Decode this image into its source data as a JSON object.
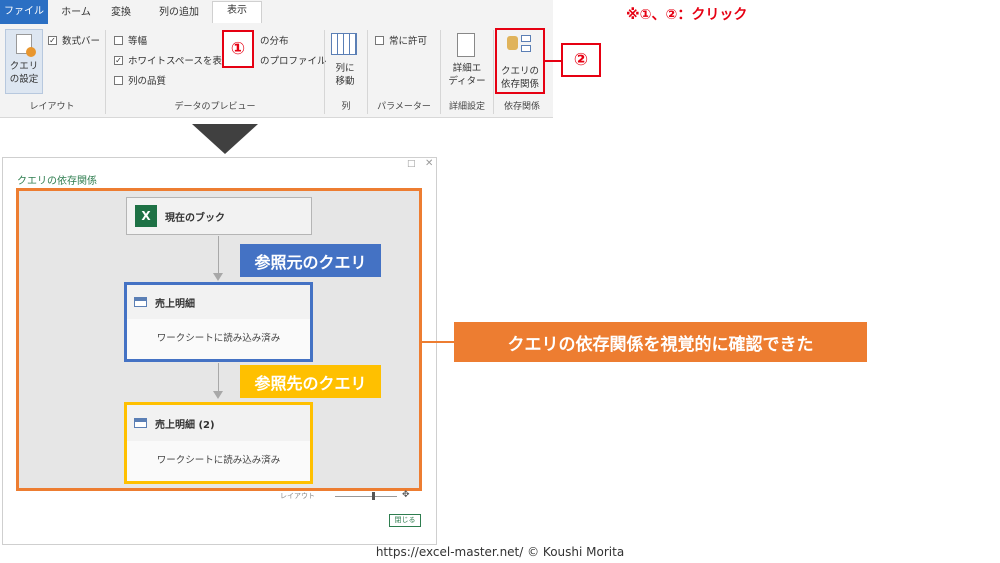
{
  "ribbon": {
    "tabs": [
      "ファイル",
      "ホーム",
      "変換",
      "列の追加",
      "表示"
    ],
    "layout_group": {
      "query_settings_btn": [
        "クエリ",
        "の設定"
      ],
      "formula_bar": "数式バー",
      "label": "レイアウト"
    },
    "preview_group": {
      "items": [
        "等幅",
        "ホワイトスペースを表示",
        "列の品質"
      ],
      "right_items": [
        "の分布",
        "のプロファイル"
      ],
      "label": "データのプレビュー"
    },
    "columns_group": {
      "button": [
        "列に",
        "移動"
      ],
      "label": "列"
    },
    "params_group": {
      "item": "常に許可",
      "label": "パラメーター"
    },
    "advanced_group": {
      "button": [
        "詳細エ",
        "ディター"
      ],
      "label": "詳細設定"
    },
    "deps_group": {
      "button": [
        "クエリの",
        "依存関係"
      ],
      "label": "依存関係"
    }
  },
  "badges": {
    "one": "①",
    "two": "②"
  },
  "instruction": "※①、②：クリック",
  "dialog": {
    "title": "クエリの依存関係",
    "source_node": "現在のブック",
    "query1": {
      "name": "売上明細",
      "status": "ワークシートに読み込み済み"
    },
    "query2": {
      "name": "売上明細 (2)",
      "status": "ワークシートに読み込み済み"
    },
    "layout_label": "レイアウト",
    "close_button": "閉じる"
  },
  "callouts": {
    "source": "参照元のクエリ",
    "target": "参照先のクエリ",
    "result": "クエリの依存関係を視覚的に確認できた"
  },
  "footer": "https://excel-master.net/  © Koushi Morita",
  "colors": {
    "accent_red": "#e60012",
    "orange": "#ed7d31",
    "blue": "#4472c4",
    "gold": "#ffc000",
    "file_tab": "#2b6fc3"
  }
}
